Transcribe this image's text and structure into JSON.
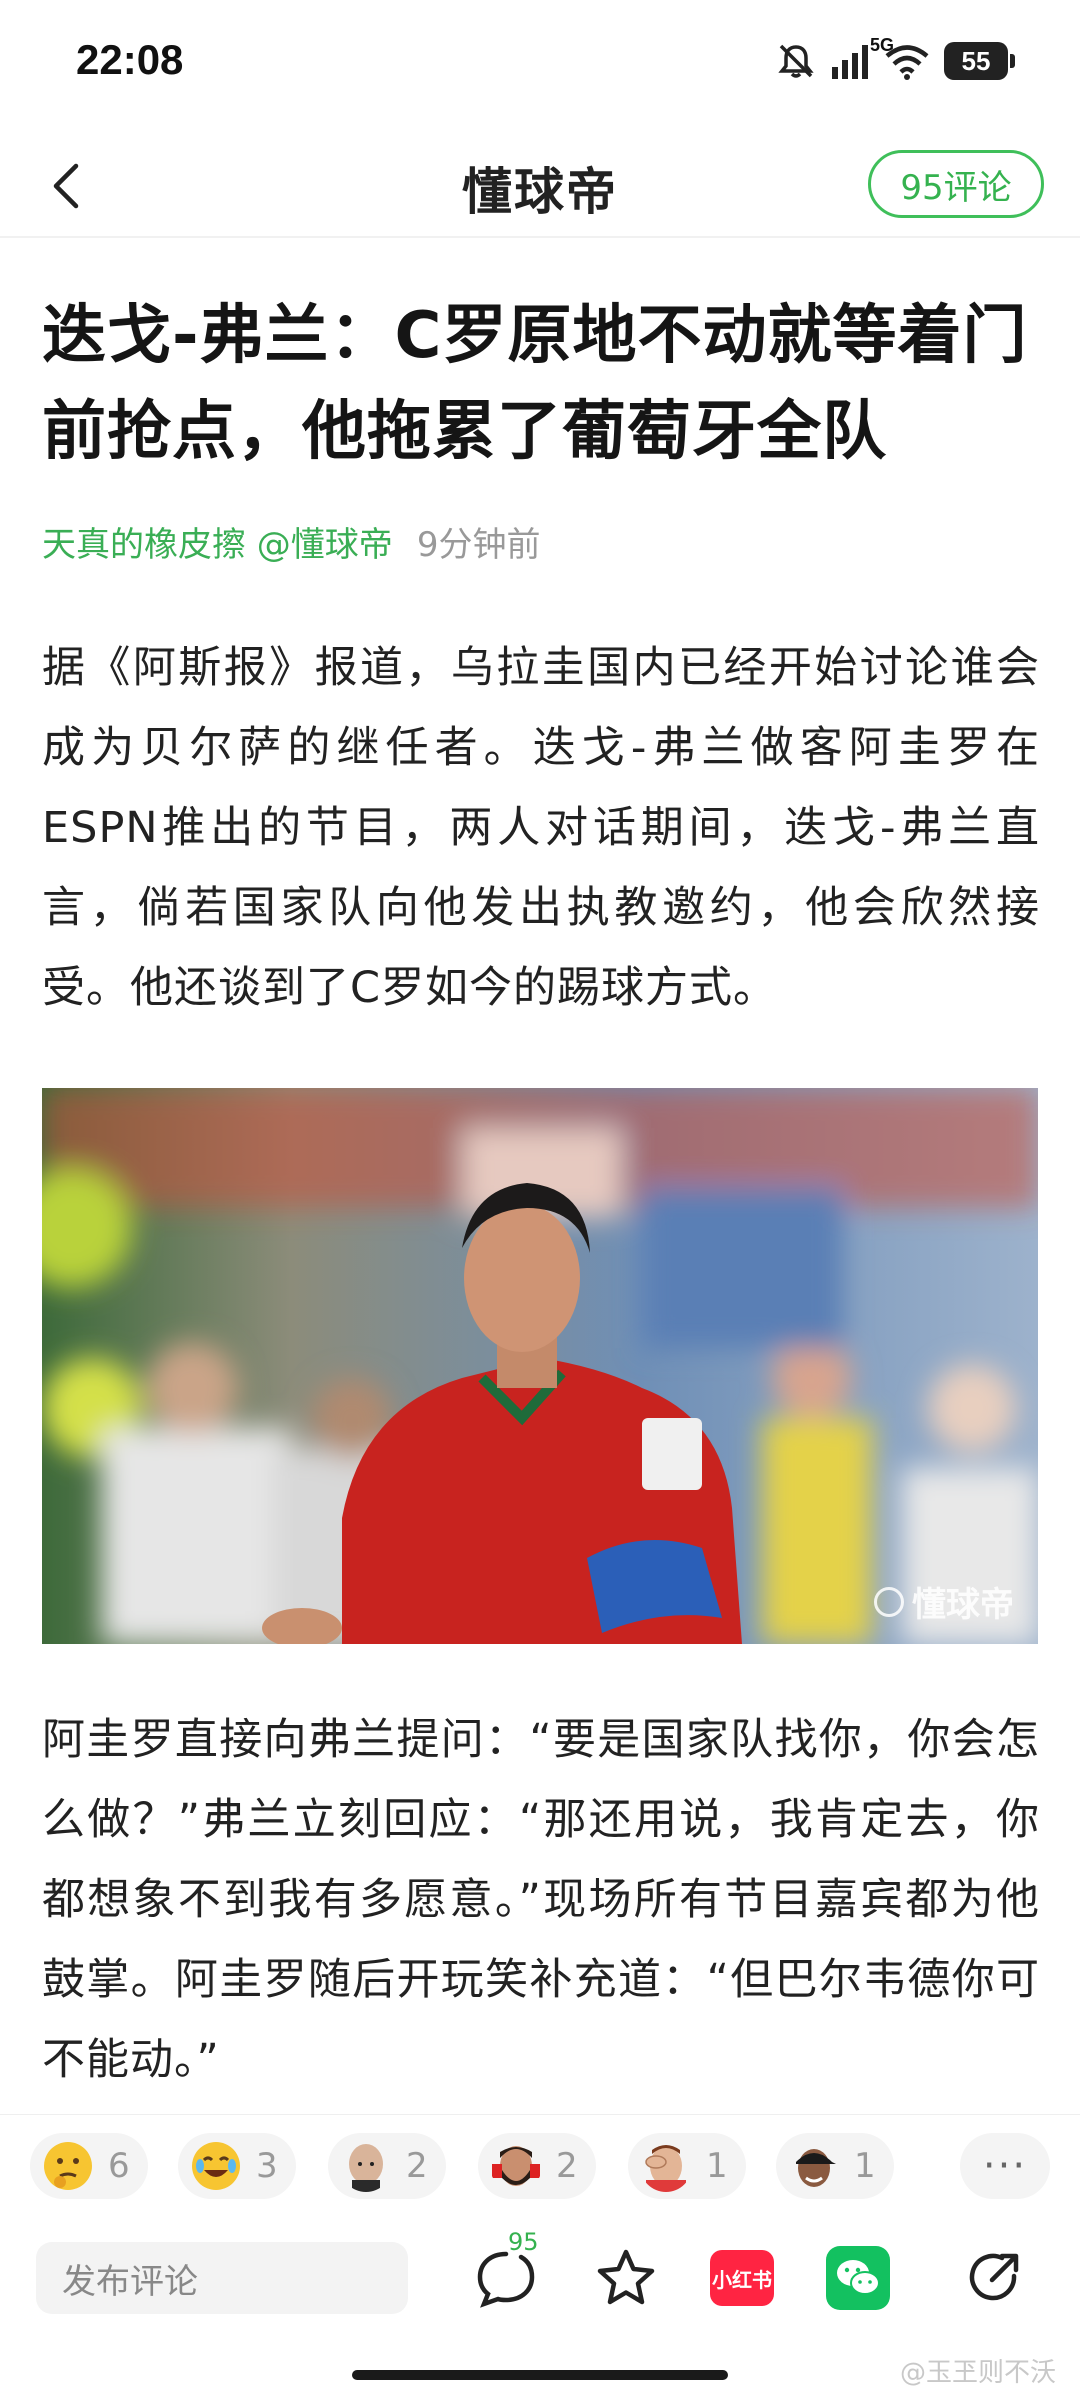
{
  "status_bar": {
    "time": "22:08",
    "network": "5G",
    "battery": "55",
    "icons": [
      "mute-bell-icon",
      "signal-icon",
      "wifi-icon",
      "battery-icon"
    ]
  },
  "nav": {
    "back_icon": "chevron-left-icon",
    "logo": "懂球帝",
    "comments_pill": "95评论"
  },
  "article": {
    "title": "迭戈-弗兰：C罗原地不动就等着门前抢点，他拖累了葡萄牙全队",
    "author": "天真的橡皮擦 @懂球帝",
    "time": "9分钟前",
    "paragraph1": "据《阿斯报》报道，乌拉圭国内已经开始讨论谁会成为贝尔萨的继任者。迭戈-弗兰做客阿圭罗在ESPN推出的节目，两人对话期间，迭戈-弗兰直言，倘若国家队向他发出执教邀约，他会欣然接受。他还谈到了C罗如今的踢球方式。",
    "image_watermark": "懂球帝",
    "paragraph2": "阿圭罗直接向弗兰提问：“要是国家队找你，你会怎么做？”弗兰立刻回应：“那还用说，我肯定去，你都想象不到我有多愿意。”现场所有节目嘉宾都为他鼓掌。阿圭罗随后开玩笑补充道：“但巴尔韦德你可不能动。”"
  },
  "reactions": [
    {
      "icon": "thinking-face-icon",
      "count": "6"
    },
    {
      "icon": "laughing-face-icon",
      "count": "3"
    },
    {
      "icon": "bald-avatar-sticker-icon",
      "count": "2"
    },
    {
      "icon": "bearded-avatar-sticker-icon",
      "count": "2"
    },
    {
      "icon": "facepalm-avatar-sticker-icon",
      "count": "1"
    },
    {
      "icon": "cap-avatar-sticker-icon",
      "count": "1"
    }
  ],
  "more_label": "···",
  "bottom_bar": {
    "comment_placeholder": "发布评论",
    "comment_count": "95",
    "xiaohongshu_label": "小红书",
    "icons": [
      "comment-bubble-icon",
      "star-icon",
      "xiaohongshu-icon",
      "wechat-icon",
      "share-icon"
    ]
  },
  "watermark": "@玉玊则不沃",
  "colors": {
    "accent_green": "#3fbf5a",
    "jersey_red": "#c8231f",
    "xhs_red": "#ff2442",
    "wechat_green": "#13c160"
  }
}
